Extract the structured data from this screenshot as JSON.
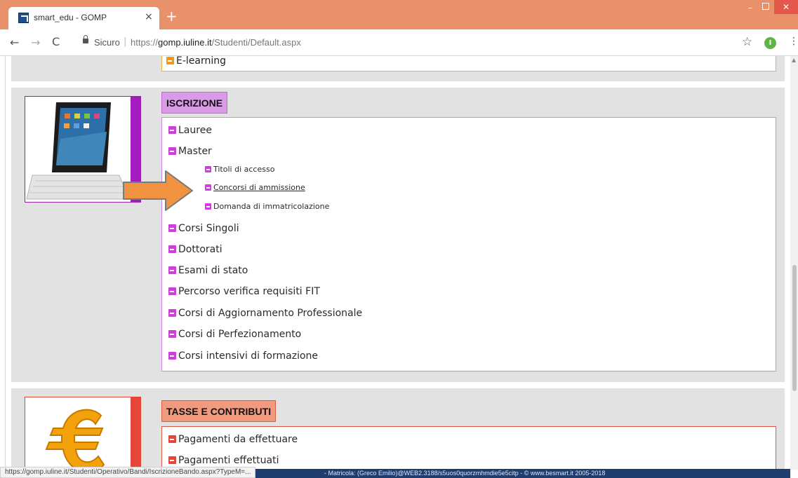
{
  "browser": {
    "tab_title": "smart_edu - GOMP",
    "tab_close": "×",
    "new_tab": "+",
    "secure_label": "Sicuro",
    "url_separator": "|",
    "url_prefix": "https://",
    "url_host": "gomp.iuline.it",
    "url_path": "/Studenti/Default.aspx",
    "profile_initial": "I",
    "back_glyph": "←",
    "forward_glyph": "→",
    "reload_glyph": "C",
    "star_glyph": "☆",
    "menu_glyph": "⋮",
    "minimize_glyph": "–",
    "close_glyph": "✕"
  },
  "previous_section": {
    "item": "E-learning"
  },
  "iscrizione": {
    "header": "ISCRIZIONE",
    "items": [
      {
        "label": "Lauree"
      },
      {
        "label": "Master"
      },
      {
        "label": "Corsi Singoli"
      },
      {
        "label": "Dottorati"
      },
      {
        "label": "Esami di stato"
      },
      {
        "label": "Percorso verifica requisiti FIT"
      },
      {
        "label": "Corsi di Aggiornamento Professionale"
      },
      {
        "label": "Corsi di Perfezionamento"
      },
      {
        "label": "Corsi intensivi di formazione"
      }
    ],
    "master_sub": [
      {
        "label": "Titoli di accesso"
      },
      {
        "label": "Concorsi di ammissione"
      },
      {
        "label": "Domanda di immatricolazione"
      }
    ]
  },
  "tasse": {
    "header": "TASSE E CONTRIBUTI",
    "items": [
      {
        "label": "Pagamenti da effettuare"
      },
      {
        "label": "Pagamenti effettuati"
      }
    ]
  },
  "status": {
    "hover_url": "https://gomp.iuline.it/Studenti/Operativo/Bandi/IscrizioneBando.aspx?TypeM=...",
    "footer_text": "- Matricola: (Greco Emilio)@WEB2.3188/s5uos0quorzmhmdie5e5citp - © www.besmart.it 2005-2018"
  },
  "colors": {
    "titlebar": "#e8916a",
    "iscrizione_accent": "#a31bc1",
    "tasse_accent": "#e8453a",
    "arrow": "#f0923f"
  },
  "icons": {
    "tablet_image": "tablet-keyboard-image",
    "euro_image": "euro-symbol-image",
    "pointer_arrow": "orange-pointer-arrow"
  }
}
